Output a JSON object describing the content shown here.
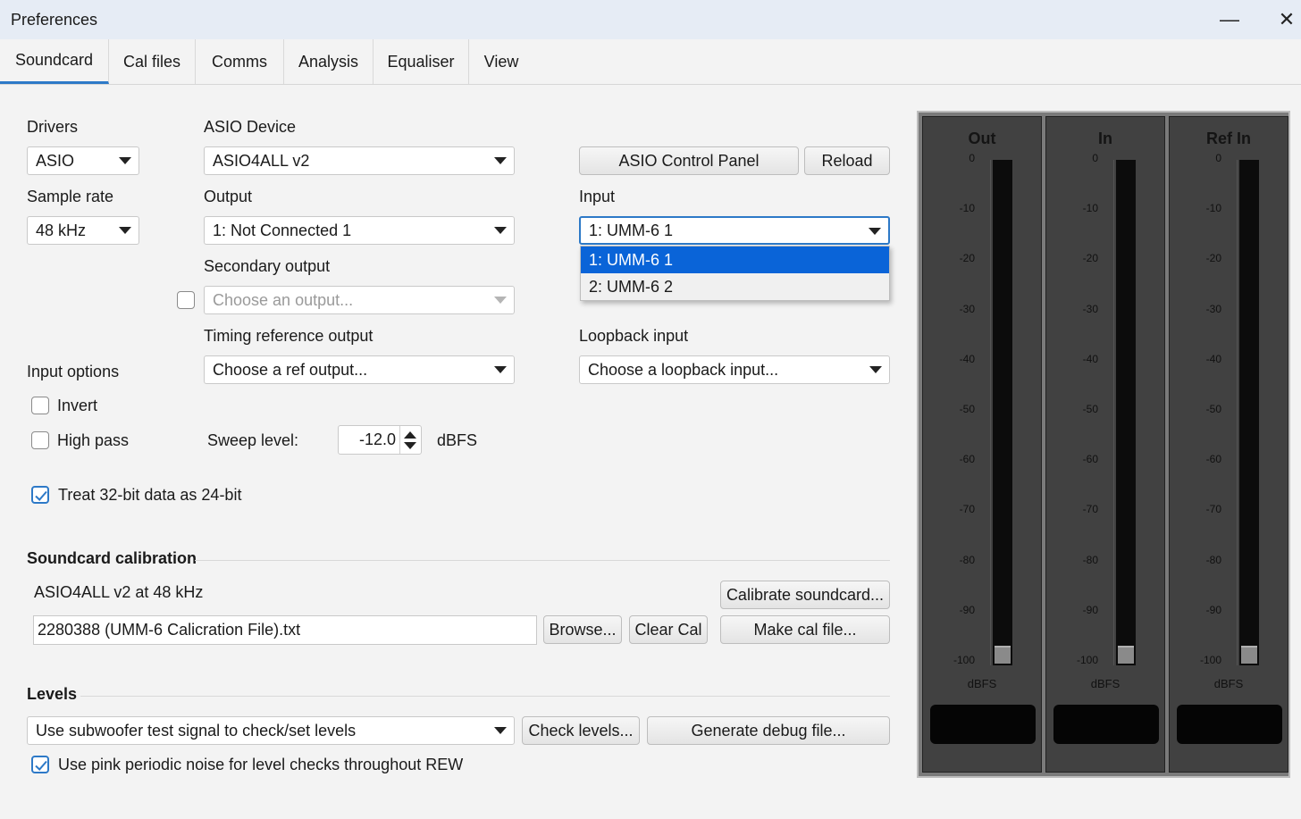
{
  "window": {
    "title": "Preferences",
    "min_glyph": "—",
    "close_glyph": "✕"
  },
  "tabs": [
    "Soundcard",
    "Cal files",
    "Comms",
    "Analysis",
    "Equaliser",
    "View"
  ],
  "active_tab": "Soundcard",
  "drivers": {
    "label": "Drivers",
    "value": "ASIO"
  },
  "asio_device": {
    "label": "ASIO Device",
    "value": "ASIO4ALL v2"
  },
  "asio_control_panel": "ASIO Control Panel",
  "reload": "Reload",
  "sample_rate": {
    "label": "Sample rate",
    "value": "48 kHz"
  },
  "output": {
    "label": "Output",
    "value": "1: Not Connected 1"
  },
  "input": {
    "label": "Input",
    "value": "1: UMM-6 1",
    "options": [
      "1: UMM-6 1",
      "2: UMM-6 2"
    ],
    "highlighted_index": 0
  },
  "secondary_output": {
    "label": "Secondary output",
    "placeholder": "Choose an output...",
    "enabled": false
  },
  "timing_reference_output": {
    "label": "Timing reference output",
    "placeholder": "Choose a ref output..."
  },
  "loopback_input": {
    "label": "Loopback input",
    "placeholder": "Choose a loopback input..."
  },
  "input_options": {
    "label": "Input options",
    "invert": {
      "label": "Invert",
      "checked": false
    },
    "high_pass": {
      "label": "High pass",
      "checked": false
    }
  },
  "sweep_level": {
    "label": "Sweep level:",
    "value": "-12.0",
    "unit": "dBFS"
  },
  "treat_32bit": {
    "label": "Treat 32-bit data as 24-bit",
    "checked": true
  },
  "soundcard_calibration": {
    "heading": "Soundcard calibration",
    "status": "ASIO4ALL v2 at 48 kHz",
    "cal_file": "2280388 (UMM-6 Calicration File).txt",
    "browse": "Browse...",
    "clear_cal": "Clear Cal",
    "calibrate": "Calibrate soundcard...",
    "make_cal_file": "Make cal file..."
  },
  "levels": {
    "heading": "Levels",
    "signal_select": "Use subwoofer test signal to check/set levels",
    "check_levels": "Check levels...",
    "generate_debug": "Generate debug file...",
    "pink_noise": {
      "label": "Use pink periodic noise for level checks throughout REW",
      "checked": true
    }
  },
  "meters": {
    "items": [
      {
        "title": "Out",
        "unit": "dBFS"
      },
      {
        "title": "In",
        "unit": "dBFS"
      },
      {
        "title": "Ref In",
        "unit": "dBFS"
      }
    ],
    "scale": [
      "0",
      "-10",
      "-20",
      "-30",
      "-40",
      "-50",
      "-60",
      "-70",
      "-80",
      "-90",
      "-100"
    ]
  },
  "colors": {
    "accent": "#2d79c7",
    "selection": "#0a64d8",
    "meter_bg": "#414141"
  }
}
